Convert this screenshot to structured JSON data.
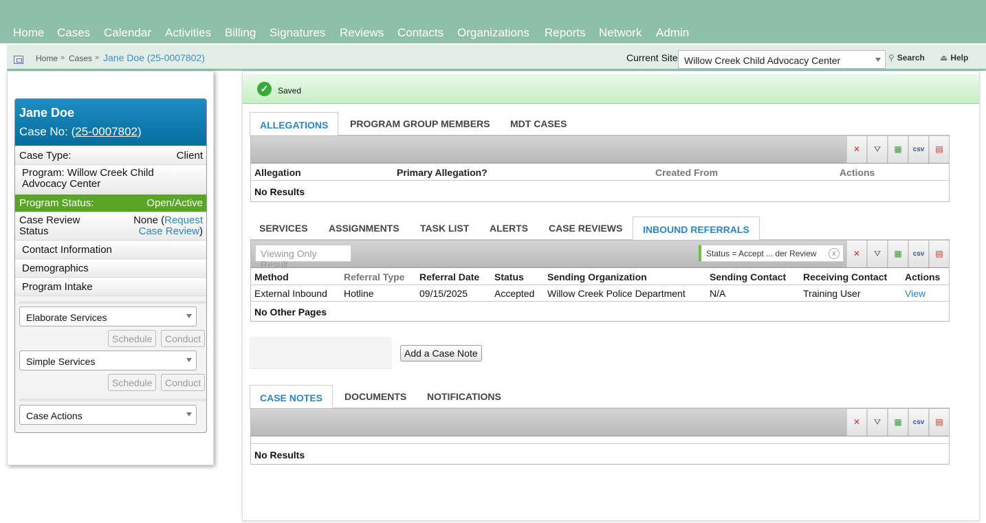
{
  "nav": {
    "items": [
      "Home",
      "Cases",
      "Calendar",
      "Activities",
      "Billing",
      "Signatures",
      "Reviews",
      "Contacts",
      "Organizations",
      "Reports",
      "Network",
      "Admin"
    ]
  },
  "breadcrumb": {
    "items": [
      "Home",
      "Cases"
    ],
    "current": "Jane Doe (25-0007802)",
    "separator": "»"
  },
  "site": {
    "label": "Current Site",
    "selected": "Willow Creek Child Advocacy Center"
  },
  "toplinks": {
    "search": "Search",
    "help": "Help"
  },
  "saved": {
    "text": "Saved"
  },
  "client": {
    "name": "Jane Doe",
    "case_no_prefix": "Case No: (",
    "case_no": "25-0007802",
    "case_no_suffix": ")",
    "case_type_label": "Case Type:",
    "case_type_value": "Client",
    "program": "Program: Willow Creek Child Advocacy Center",
    "program_status_label": "Program Status:",
    "program_status_value": "Open/Active",
    "review_label_1": "Case Review",
    "review_label_2": "Status",
    "review_value_prefix": "None (",
    "review_link_1": "Request",
    "review_link_2": "Case Review",
    "review_value_suffix": ")",
    "contact_info": "Contact Information",
    "demographics": "Demographics",
    "program_intake": "Program Intake",
    "elaborate_services": "Elaborate Services",
    "simple_services": "Simple Services",
    "schedule": "Schedule",
    "conduct": "Conduct",
    "case_actions": "Case Actions"
  },
  "allegations": {
    "tabs": [
      "ALLEGATIONS",
      "PROGRAM GROUP MEMBERS",
      "MDT CASES"
    ],
    "columns": [
      "Allegation",
      "Primary Allegation?",
      "Created From",
      "Actions"
    ],
    "empty": "No Results"
  },
  "services": {
    "tabs": [
      "SERVICES",
      "ASSIGNMENTS",
      "TASK LIST",
      "ALERTS",
      "CASE REVIEWS",
      "INBOUND REFERRALS"
    ],
    "viewing_only": "Viewing Only Result",
    "filter": "Status = Accept ... der Review",
    "filter_clear": "x",
    "columns": [
      "Method",
      "Referral Type",
      "Referral Date",
      "Status",
      "Sending Organization",
      "Sending Contact",
      "Receiving Contact",
      "Actions"
    ],
    "rows": [
      [
        "External Inbound",
        "Hotline",
        "09/15/2025",
        "Accepted",
        "Willow Creek Police Department",
        "N/A",
        "Training User",
        "View"
      ]
    ],
    "footer": "No Other Pages"
  },
  "case_note": {
    "button": "Add a Case Note"
  },
  "notes": {
    "tabs": [
      "CASE NOTES",
      "DOCUMENTS",
      "NOTIFICATIONS"
    ],
    "empty": "No Results"
  },
  "toolbar_icons": [
    "clear-filter-icon",
    "filter-icon",
    "excel-export-icon",
    "csv-export-icon",
    "pdf-export-icon"
  ],
  "toolbar_glyphs": {
    "clear": "✕",
    "filter": "⛛",
    "excel": "▦",
    "csv": "csv",
    "pdf": "▤"
  }
}
